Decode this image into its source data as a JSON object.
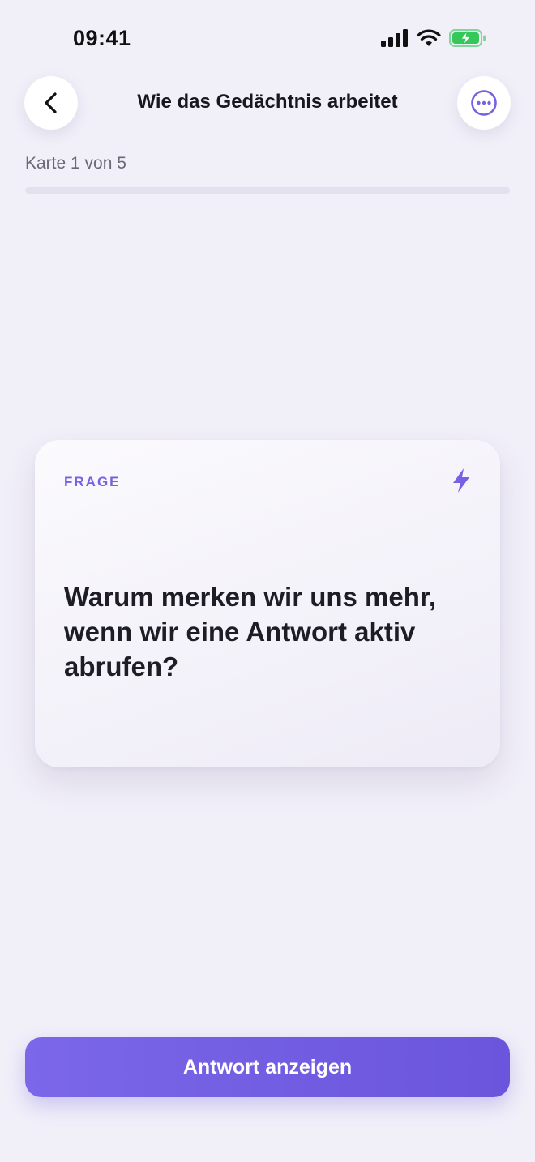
{
  "status_bar": {
    "time": "09:41",
    "icons": [
      "cellular-signal-icon",
      "wifi-icon",
      "battery-charging-icon"
    ],
    "battery_color": "#34c759"
  },
  "header": {
    "title": "Wie das Gedächtnis arbeitet",
    "back_icon": "chevron-left-icon",
    "more_icon": "more-horizontal-icon"
  },
  "progress": {
    "label": "Karte 1 von 5",
    "current": 1,
    "total": 5,
    "fraction": 0.0
  },
  "card": {
    "tag": "FRAGE",
    "icon": "lightning-bolt-icon",
    "question": "Warum merken wir uns mehr, wenn wir eine Antwort aktiv abrufen?"
  },
  "primary_action": {
    "label": "Antwort anzeigen"
  },
  "colors": {
    "accent": "#7660e4",
    "background": "#f1eff8",
    "text": "#1c1b22"
  }
}
